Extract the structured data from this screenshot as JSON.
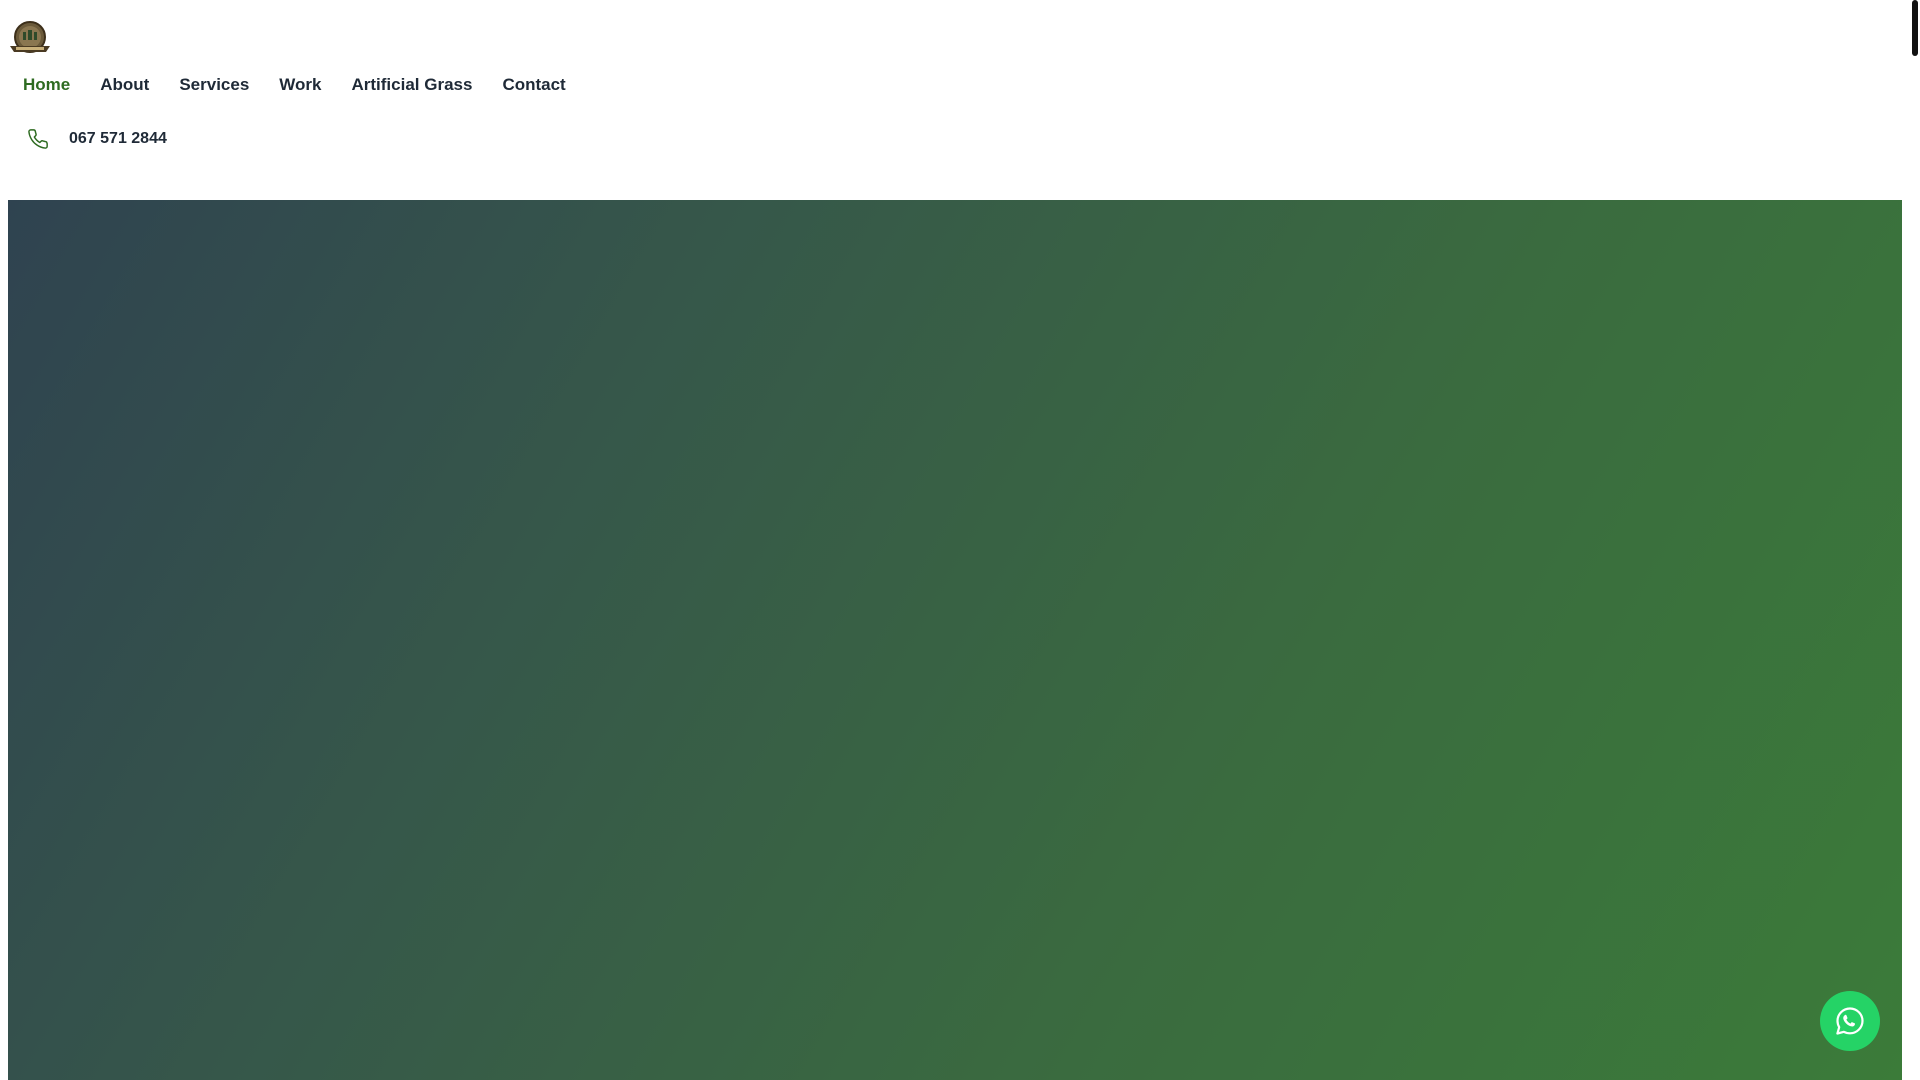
{
  "header": {
    "logo_icon": "company-badge-logo",
    "nav": [
      {
        "label": "Home",
        "active": true
      },
      {
        "label": "About",
        "active": false
      },
      {
        "label": "Services",
        "active": false
      },
      {
        "label": "Work",
        "active": false
      },
      {
        "label": "Artificial Grass",
        "active": false
      },
      {
        "label": "Contact",
        "active": false
      }
    ],
    "phone": {
      "icon": "phone-icon",
      "number": "067 571 2844"
    }
  },
  "hero": {
    "gradient_start": "#2f4350",
    "gradient_end": "#3b7b39"
  },
  "floating": {
    "whatsapp_icon": "whatsapp-icon",
    "whatsapp_color": "#25d366"
  },
  "colors": {
    "accent": "#2e6b21",
    "text": "#1f2a37"
  }
}
